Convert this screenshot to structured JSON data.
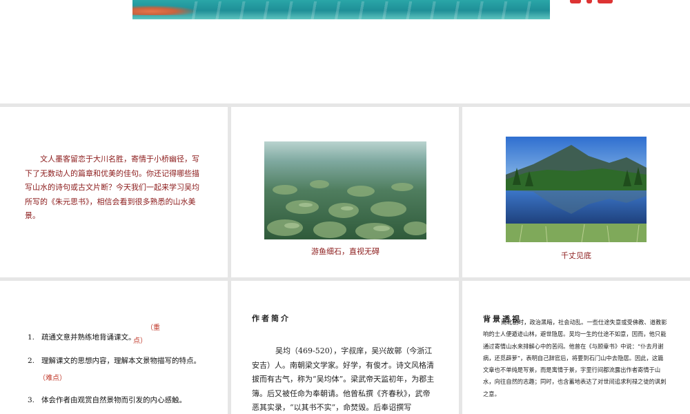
{
  "intro_slide": {
    "text": "文人墨客留恋于大川名胜，寄情于小桥幽径，写下了无数动人的篇章和优美的佳句。你还记得哪些描写山水的诗句或古文片断？今天我们一起来学习吴均所写的《朱元思书》，相信会看到很多熟悉的山水美景。"
  },
  "water_slide": {
    "caption": "游鱼细石，直视无碍"
  },
  "lake_slide": {
    "caption": "千丈见底"
  },
  "goals_slide": {
    "items": [
      {
        "num": "1.",
        "text": "疏通文意并熟练地背诵课文。"
      },
      {
        "num": "2.",
        "text": "理解课文的思想内容，理解本文景物描写的特点。"
      },
      {
        "num": "3.",
        "text": "体会作者由观赏自然景物而引发的内心感触。"
      }
    ],
    "mark_key_open": "（重",
    "mark_key_close": "点）",
    "mark_difficult": "（难点）"
  },
  "author_slide": {
    "title": "作者简介",
    "text": "吴均（469-520），字叔庠，吴兴故鄣（今浙江安吉）人。南朝梁文学家。好学，有俊才。诗文风格清拔而有古气，称为“吴均体”。梁武帝天监初年，为郡主簿。后又被任命为奉朝请。他曾私撰《齐春秋》，武帝恶其实录，“以其书不实”，命焚毁。后奉诏撰写"
  },
  "background_slide": {
    "title": "背景透视",
    "text": "南北朝时，政治黑暗，社会动乱。一些仕途失意或受佛教、道教影响的士人便遁迹山林，避世隐居。吴均一生的仕途不如意，因而，他只能通过寄情山水来排解心中的苦闷。他曾在《与顾章书》中说：“仆去月谢病，还觅薜萝”，表明自己辞官后，将要到石门山中去隐居。因此，这篇文章也不单纯是写景，而是寓情于景，字里行间都流露出作者寄情于山水，向往自然的志趣；同时，也含蓄地表达了对世间追求利禄之徒的讽刺之意。"
  }
}
